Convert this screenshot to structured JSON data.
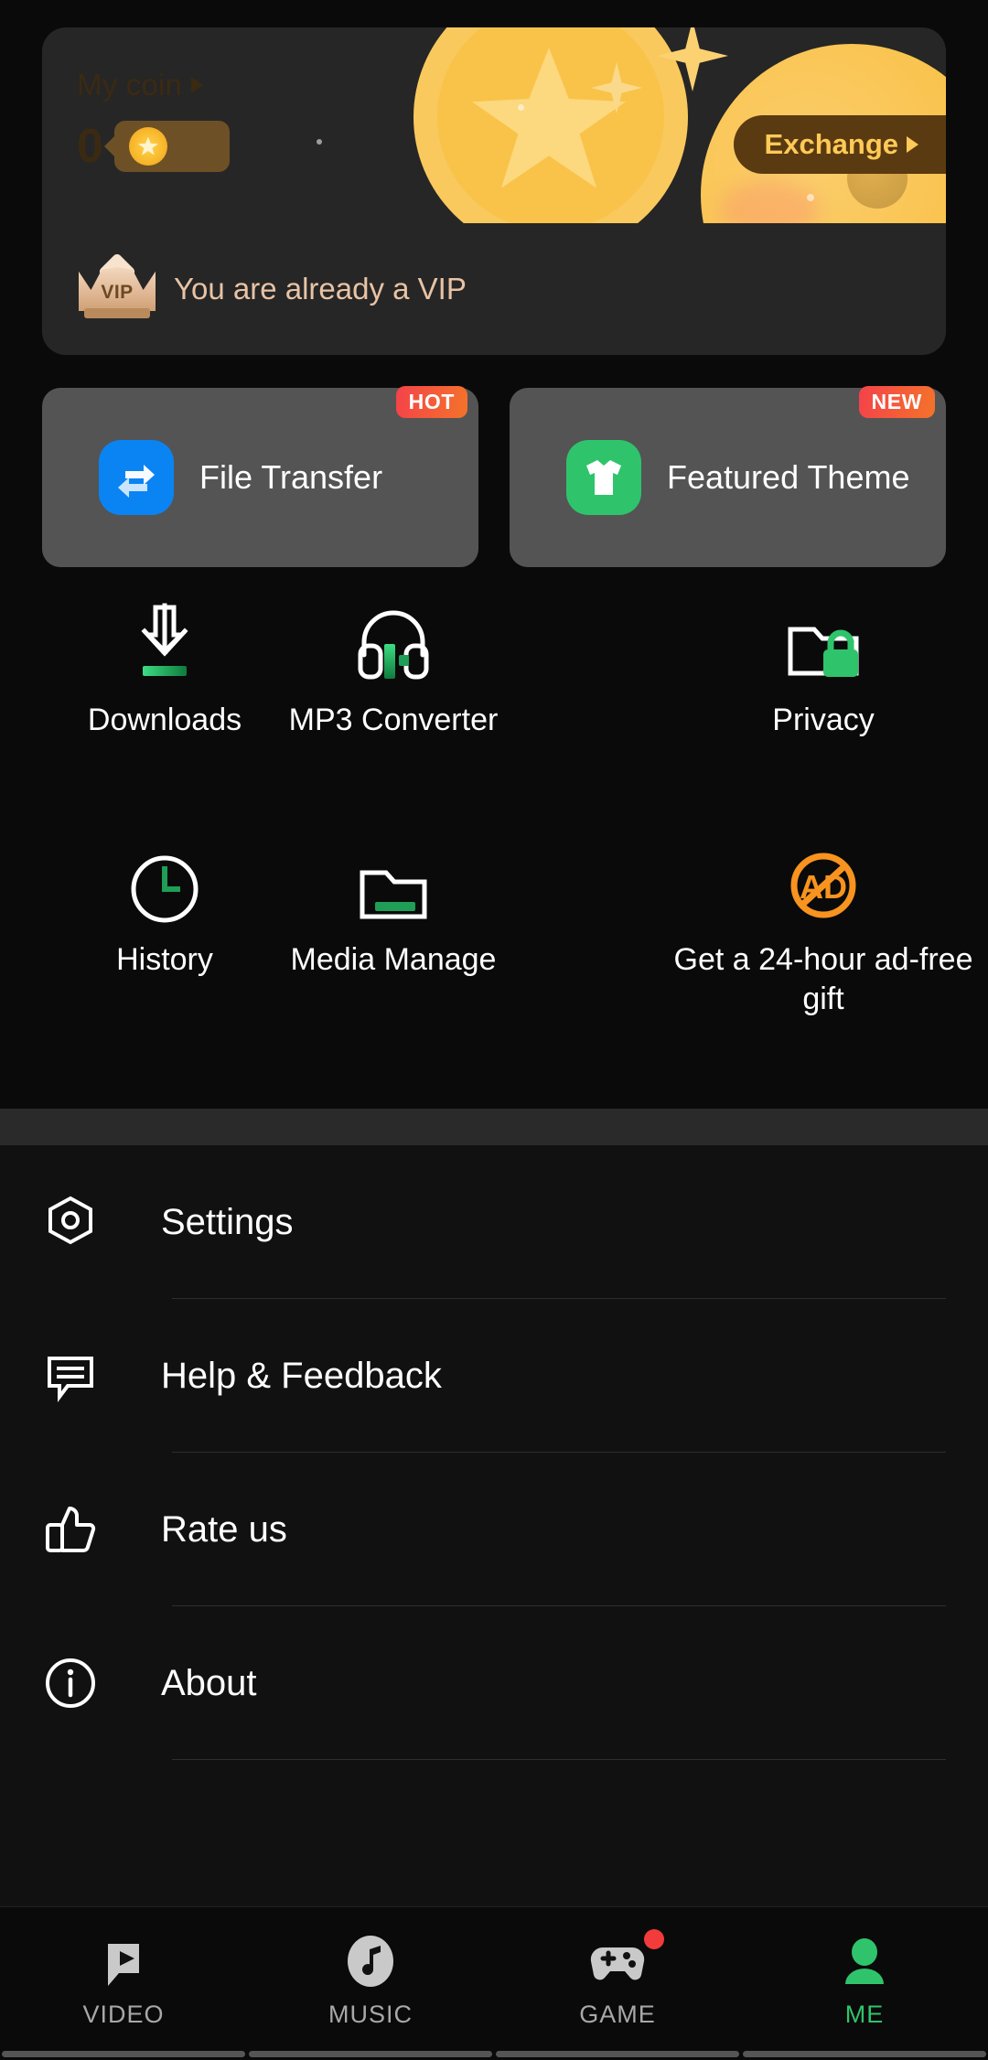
{
  "coin_banner": {
    "my_coin_label": "My coin",
    "coin_amount": "0",
    "exchange_label": "Exchange",
    "vip_text": "You are already a VIP",
    "vip_badge_text": "VIP",
    "accent_gold": "#f9c349",
    "pill_brown": "#6e5026",
    "exchange_bg": "#5a3a10",
    "exchange_fg": "#ffca57"
  },
  "feature_cards": [
    {
      "label": "File Transfer",
      "badge": "HOT",
      "icon": "file-transfer-icon",
      "icon_color": "#0b84f3"
    },
    {
      "label": "Featured Theme",
      "badge": "NEW",
      "icon": "tshirt-icon",
      "icon_color": "#2fc46b"
    }
  ],
  "tools": [
    {
      "label": "Downloads",
      "icon": "download-icon"
    },
    {
      "label": "MP3 Converter",
      "icon": "headphones-icon"
    },
    {
      "label": "Privacy",
      "icon": "folder-lock-icon"
    },
    {
      "label": "History",
      "icon": "clock-icon"
    },
    {
      "label": "Media Manage",
      "icon": "folder-icon"
    },
    {
      "label": "Get a 24-hour ad-free gift",
      "icon": "no-ads-icon"
    }
  ],
  "menu": [
    {
      "label": "Settings",
      "icon": "gear-icon"
    },
    {
      "label": "Help & Feedback",
      "icon": "chat-icon"
    },
    {
      "label": "Rate us",
      "icon": "thumbs-up-icon"
    },
    {
      "label": "About",
      "icon": "info-icon"
    }
  ],
  "bottom_nav": [
    {
      "label": "VIDEO",
      "icon": "video-icon",
      "active": false,
      "badge": false
    },
    {
      "label": "MUSIC",
      "icon": "music-icon",
      "active": false,
      "badge": false
    },
    {
      "label": "GAME",
      "icon": "gamepad-icon",
      "active": false,
      "badge": true
    },
    {
      "label": "ME",
      "icon": "person-icon",
      "active": true,
      "badge": false
    }
  ],
  "colors": {
    "green": "#2fc46b",
    "orange": "#f7931e",
    "red": "#f23b3b"
  }
}
